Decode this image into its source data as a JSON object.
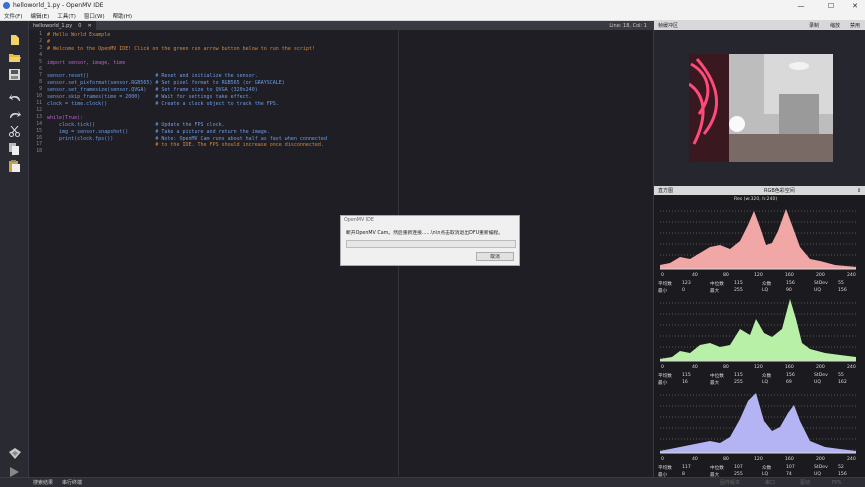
{
  "window": {
    "title": "helloworld_1.py - OpenMV IDE",
    "controls": [
      "—",
      "☐",
      "✕"
    ]
  },
  "menu": [
    "文件(F)",
    "编辑(E)",
    "工具(T)",
    "窗口(W)",
    "帮助(H)"
  ],
  "editor": {
    "tab_label": "helloworld_1.py",
    "tab_extra": "0",
    "tab_close": "✕",
    "cursor_pos": "Line: 18, Col: 1",
    "line_numbers": [
      "1",
      "2",
      "3",
      "4",
      "5",
      "6",
      "7",
      "8",
      "9",
      "10",
      "11",
      "12",
      "13",
      "14",
      "15",
      "16",
      "17",
      "18"
    ],
    "lines": [
      "# Hello World Example",
      "#",
      "# Welcome to the OpenMV IDE! Click on the green run arrow button below to run the script!",
      "",
      "import sensor, image, time",
      "",
      "sensor.reset()                      # Reset and initialize the sensor.",
      "sensor.set_pixformat(sensor.RGB565) # Set pixel format to RGB565 (or GRAYSCALE)",
      "sensor.set_framesize(sensor.QVGA)   # Set frame size to QVGA (320x240)",
      "sensor.skip_frames(time = 2000)     # Wait for settings take effect.",
      "clock = time.clock()                # Create a clock object to track the FPS.",
      "",
      "while(True):",
      "    clock.tick()                    # Update the FPS clock.",
      "    img = sensor.snapshot()         # Take a picture and return the image.",
      "    print(clock.fps())              # Note: OpenMV Cam runs about half as fast when connected",
      "                                    # to the IDE. The FPS should increase once disconnected.",
      ""
    ]
  },
  "framebuffer": {
    "title": "帧缓冲区",
    "buttons": [
      "录制",
      "缩放",
      "禁用"
    ]
  },
  "histogram": {
    "title": "直方图",
    "colorspace": "RGB色彩空间",
    "resolution": "Res (w:320, h:240)",
    "axis_ticks": [
      "0",
      "40",
      "80",
      "120",
      "160",
      "200",
      "240"
    ],
    "channels": [
      {
        "color": "#f2a7a7",
        "stats": {
          "平均数": "123",
          "中位数": "115",
          "众数": "156",
          "StDev": "55",
          "最小": "0",
          "最大": "255",
          "LQ": "90",
          "UQ": "156"
        }
      },
      {
        "color": "#b9f0a8",
        "stats": {
          "平均数": "115",
          "中位数": "115",
          "众数": "156",
          "StDev": "55",
          "最小": "16",
          "最大": "255",
          "LQ": "69",
          "UQ": "162"
        }
      },
      {
        "color": "#b4b4f4",
        "stats": {
          "平均数": "117",
          "中位数": "107",
          "众数": "107",
          "StDev": "52",
          "最小": "8",
          "最大": "255",
          "LQ": "74",
          "UQ": "156"
        }
      }
    ]
  },
  "dialog": {
    "title": "OpenMV IDE",
    "message": "断开OpenMV Cam。然后重新连接......\\n\\n点击取消退出DFU重新编程。",
    "cancel_label": "取消"
  },
  "statusbar": {
    "left": [
      "搜索结果",
      "串行终端"
    ],
    "right": [
      "固件版本",
      "串口",
      "驱动",
      "FPS"
    ]
  }
}
